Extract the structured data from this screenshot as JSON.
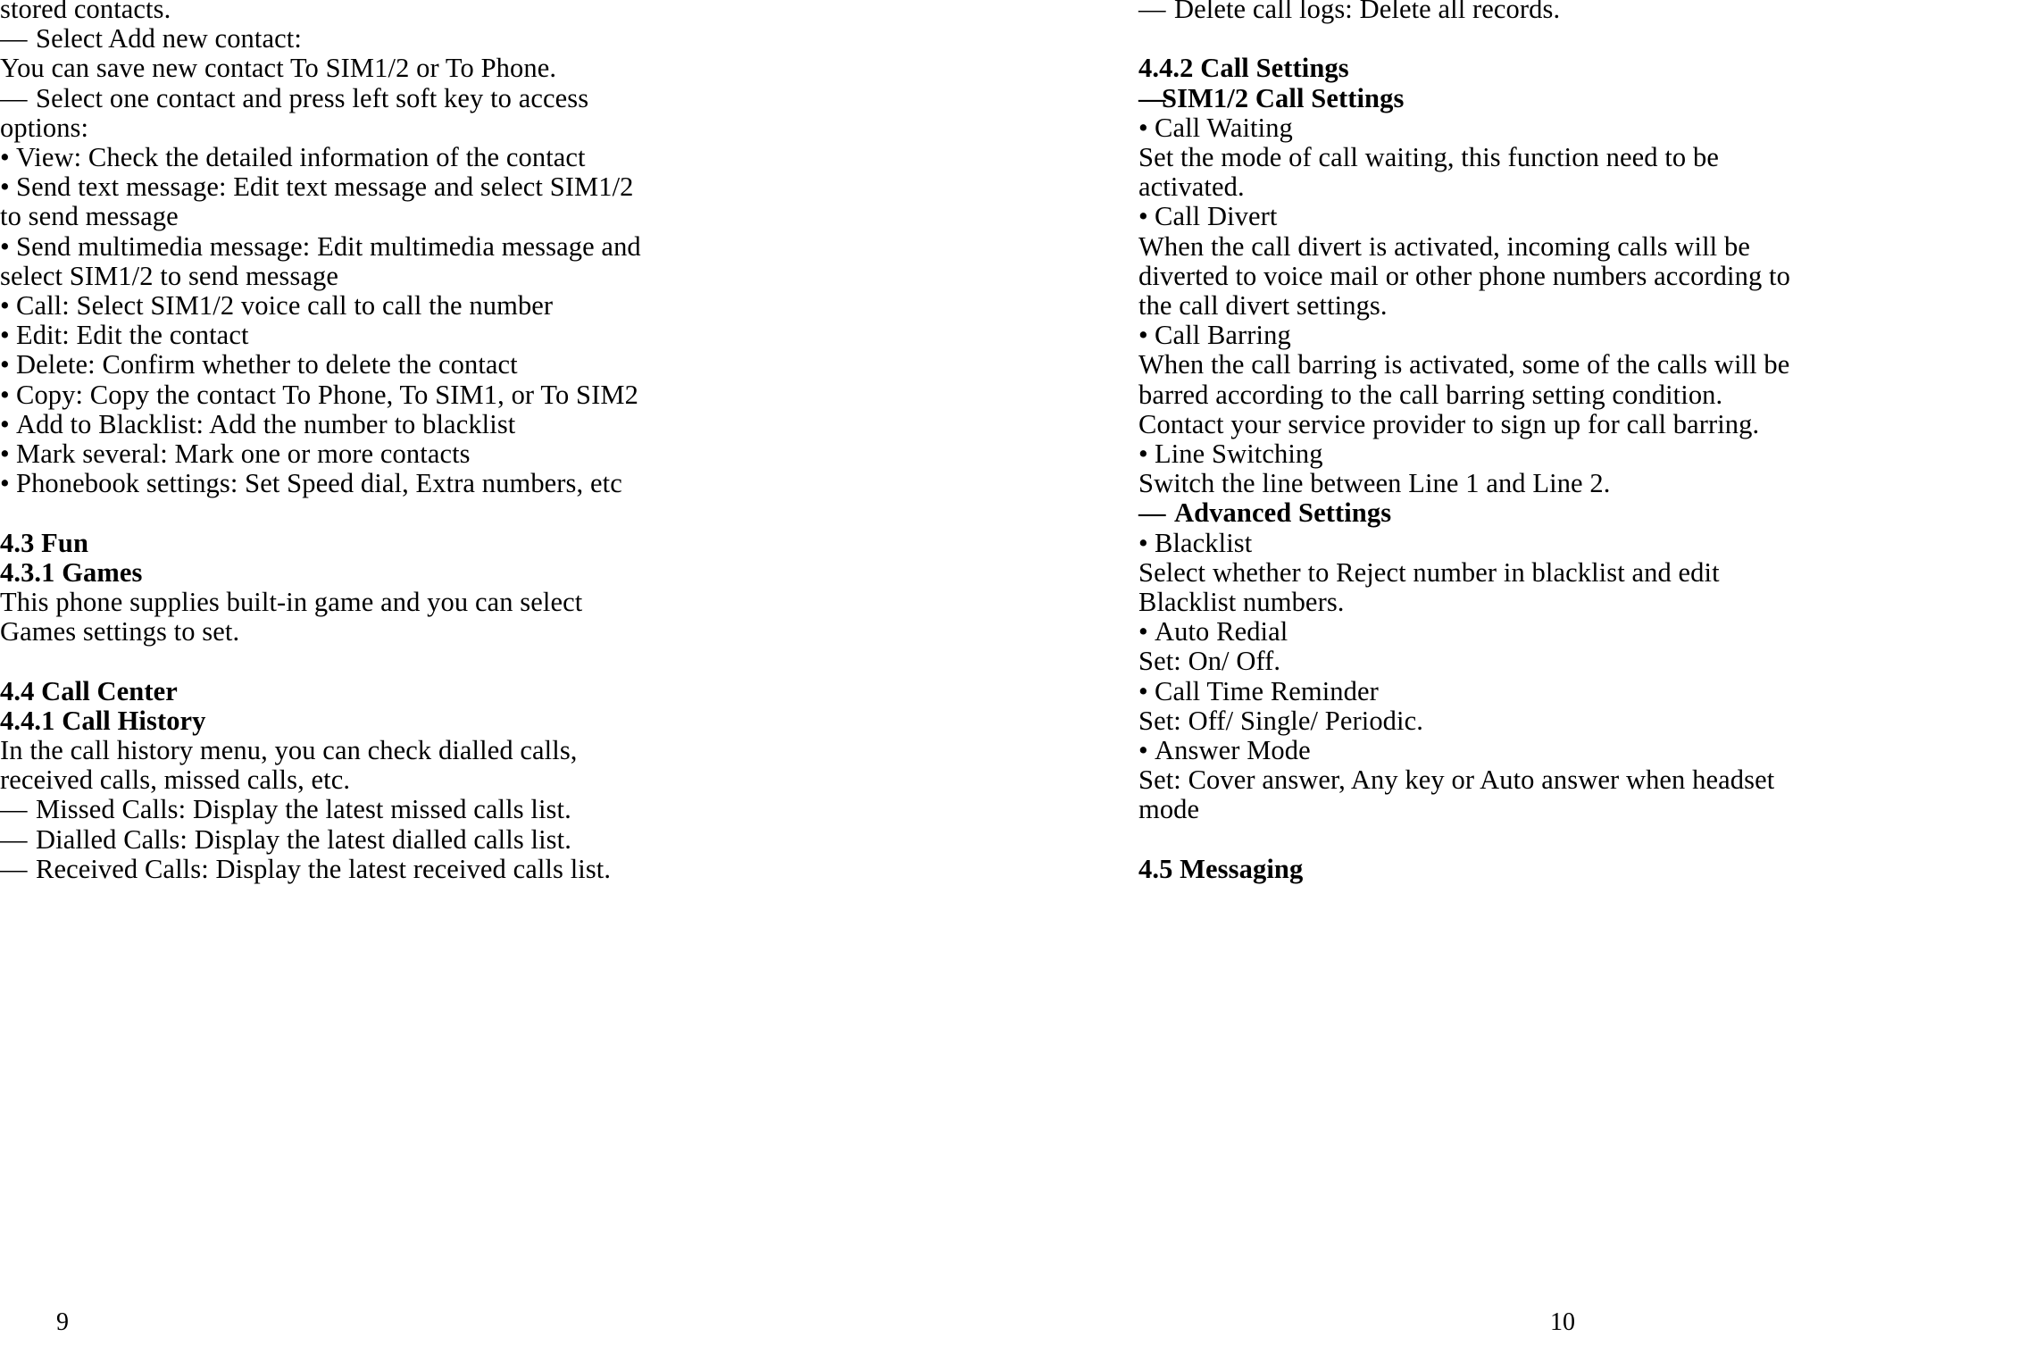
{
  "document": {
    "type": "mobile-phone-user-manual-spread",
    "left_page": {
      "page_number": "9",
      "lines": [
        {
          "id": "l1",
          "marker": "",
          "text": "stored contacts.",
          "bold": false
        },
        {
          "id": "l2",
          "marker": "—",
          "text": "Select Add new contact:",
          "bold": false
        },
        {
          "id": "l3",
          "marker": "",
          "text": "You can save new contact To SIM1/2 or To Phone.",
          "bold": false
        },
        {
          "id": "l4",
          "marker": "—",
          "text": "Select one contact and press left soft key to access",
          "bold": false
        },
        {
          "id": "l5",
          "marker": "",
          "text": "options:",
          "bold": false
        },
        {
          "id": "l6",
          "marker": "•",
          "text": "View: Check the detailed information of the contact",
          "bold": false
        },
        {
          "id": "l7",
          "marker": "•",
          "text": "Send text message: Edit text message and select SIM1/2",
          "bold": false
        },
        {
          "id": "l8",
          "marker": "",
          "text": "to send message",
          "bold": false
        },
        {
          "id": "l9",
          "marker": "•",
          "text": "Send multimedia message: Edit multimedia message and",
          "bold": false
        },
        {
          "id": "l10",
          "marker": "",
          "text": "select SIM1/2 to send message",
          "bold": false
        },
        {
          "id": "l11",
          "marker": "•",
          "text": "Call: Select SIM1/2 voice call to call the number",
          "bold": false
        },
        {
          "id": "l12",
          "marker": "•",
          "text": "Edit: Edit the contact",
          "bold": false
        },
        {
          "id": "l13",
          "marker": "•",
          "text": "Delete: Confirm whether to delete the contact",
          "bold": false
        },
        {
          "id": "l14",
          "marker": "•",
          "text": "Copy: Copy the contact To Phone, To SIM1, or To SIM2",
          "bold": false
        },
        {
          "id": "l15",
          "marker": "•",
          "text": "Add to Blacklist: Add the number to blacklist",
          "bold": false
        },
        {
          "id": "l16",
          "marker": "•",
          "text": "Mark several: Mark one or more contacts",
          "bold": false
        },
        {
          "id": "l17",
          "marker": "•",
          "text": "Phonebook settings: Set Speed dial, Extra numbers, etc",
          "bold": false
        },
        {
          "id": "l18",
          "marker": "",
          "text": "",
          "bold": false,
          "blank": true
        },
        {
          "id": "l19",
          "marker": "",
          "text": "4.3 Fun",
          "bold": true
        },
        {
          "id": "l20",
          "marker": "",
          "text": "4.3.1 Games",
          "bold": true
        },
        {
          "id": "l21",
          "marker": "",
          "text": "This phone supplies built-in game and you can select",
          "bold": false
        },
        {
          "id": "l22",
          "marker": "",
          "text": "Games settings to set.",
          "bold": false
        },
        {
          "id": "l23",
          "marker": "",
          "text": "",
          "bold": false,
          "blank": true
        },
        {
          "id": "l24",
          "marker": "",
          "text": "4.4 Call Center",
          "bold": true
        },
        {
          "id": "l25",
          "marker": "",
          "text": "4.4.1 Call History",
          "bold": true
        },
        {
          "id": "l26",
          "marker": "",
          "text": "In the call history menu, you can check dialled calls,",
          "bold": false
        },
        {
          "id": "l27",
          "marker": "",
          "text": "received calls, missed calls, etc.",
          "bold": false
        },
        {
          "id": "l28",
          "marker": "—",
          "text": "Missed Calls: Display the latest missed calls list.",
          "bold": false
        },
        {
          "id": "l29",
          "marker": "—",
          "text": "Dialled Calls: Display the latest dialled calls list.",
          "bold": false
        },
        {
          "id": "l30",
          "marker": "—",
          "text": "Received Calls: Display the latest received calls list.",
          "bold": false
        }
      ]
    },
    "right_page": {
      "page_number": "10",
      "lines": [
        {
          "id": "r1",
          "marker": "—",
          "text": "Delete call logs: Delete all records.",
          "bold": false
        },
        {
          "id": "r2",
          "marker": "",
          "text": "",
          "bold": false,
          "blank": true
        },
        {
          "id": "r3",
          "marker": "",
          "text": "4.4.2 Call Settings",
          "bold": true
        },
        {
          "id": "r4",
          "marker": "—",
          "text": "SIM1/2 Call Settings",
          "bold": true,
          "tight": true
        },
        {
          "id": "r5",
          "marker": "•",
          "text": "Call Waiting",
          "bold": false
        },
        {
          "id": "r6",
          "marker": "",
          "text": "Set the mode of call waiting, this function need to be",
          "bold": false
        },
        {
          "id": "r7",
          "marker": "",
          "text": "activated.",
          "bold": false
        },
        {
          "id": "r8",
          "marker": "•",
          "text": "Call Divert",
          "bold": false
        },
        {
          "id": "r9",
          "marker": "",
          "text": "When the call divert is activated, incoming calls will be",
          "bold": false
        },
        {
          "id": "r10",
          "marker": "",
          "text": "diverted to voice mail or other phone numbers according to",
          "bold": false
        },
        {
          "id": "r11",
          "marker": "",
          "text": "the call divert settings.",
          "bold": false
        },
        {
          "id": "r12",
          "marker": "•",
          "text": "Call Barring",
          "bold": false
        },
        {
          "id": "r13",
          "marker": "",
          "text": "When the call barring is activated, some of the calls will be",
          "bold": false
        },
        {
          "id": "r14",
          "marker": "",
          "text": "barred according to the call barring setting condition.",
          "bold": false
        },
        {
          "id": "r15",
          "marker": "",
          "text": "Contact your service provider to sign up for call barring.",
          "bold": false
        },
        {
          "id": "r16",
          "marker": "•",
          "text": "Line Switching",
          "bold": false
        },
        {
          "id": "r17",
          "marker": "",
          "text": "Switch the line between Line 1 and Line 2.",
          "bold": false
        },
        {
          "id": "r18",
          "marker": "—",
          "text": "Advanced Settings",
          "bold": true
        },
        {
          "id": "r19",
          "marker": "•",
          "text": "Blacklist",
          "bold": false
        },
        {
          "id": "r20",
          "marker": "",
          "text": "Select whether to Reject number in blacklist and edit",
          "bold": false
        },
        {
          "id": "r21",
          "marker": "",
          "text": "Blacklist numbers.",
          "bold": false
        },
        {
          "id": "r22",
          "marker": "•",
          "text": "Auto Redial",
          "bold": false
        },
        {
          "id": "r23",
          "marker": "",
          "text": "Set: On/ Off.",
          "bold": false
        },
        {
          "id": "r24",
          "marker": "•",
          "text": "Call Time Reminder",
          "bold": false
        },
        {
          "id": "r25",
          "marker": "",
          "text": "Set: Off/ Single/ Periodic.",
          "bold": false
        },
        {
          "id": "r26",
          "marker": "•",
          "text": "Answer Mode",
          "bold": false
        },
        {
          "id": "r27",
          "marker": "",
          "text": "Set: Cover answer, Any key or Auto answer when headset",
          "bold": false
        },
        {
          "id": "r28",
          "marker": "",
          "text": "mode",
          "bold": false
        },
        {
          "id": "r29",
          "marker": "",
          "text": "",
          "bold": false,
          "blank": true
        },
        {
          "id": "r30",
          "marker": "",
          "text": "4.5 Messaging",
          "bold": true
        }
      ]
    }
  }
}
